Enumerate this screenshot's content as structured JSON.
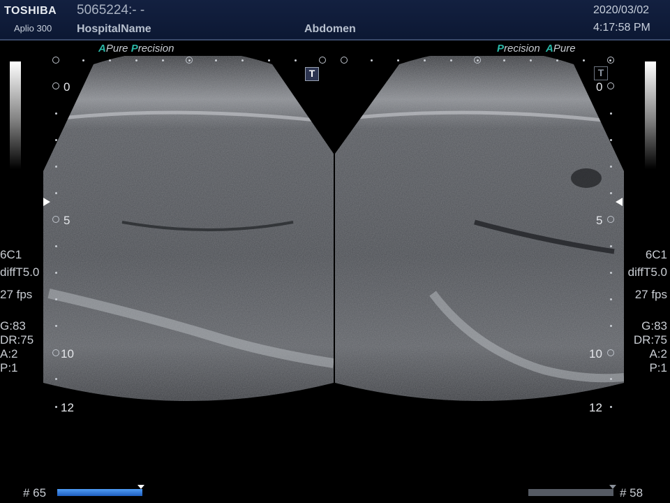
{
  "header": {
    "brand": "TOSHIBA",
    "model": "Aplio 300",
    "patient_id": "5065224:- -",
    "hospital": "HospitalName",
    "exam": "Abdomen",
    "date": "2020/03/02",
    "time": "4:17:58 PM"
  },
  "left_panel": {
    "tags": {
      "a": "A",
      "pure": "Pure",
      "p": "P",
      "recision": "recision"
    },
    "depth_labels": [
      "0",
      "5",
      "10",
      "12"
    ],
    "params": {
      "probe": "6C1",
      "mode": "diffT5.0",
      "fps": "27 fps",
      "gain": "G:83",
      "dr": "DR:75",
      "a": "A:2",
      "p": "P:1"
    },
    "t_button": "T"
  },
  "right_panel": {
    "tags": {
      "p": "P",
      "recision": "recision",
      "a": "A",
      "pure": "Pure"
    },
    "depth_labels": [
      "0",
      "5",
      "10",
      "12"
    ],
    "params": {
      "probe": "6C1",
      "mode": "diffT5.0",
      "fps": "27 fps",
      "gain": "G:83",
      "dr": "DR:75",
      "a": "A:2",
      "p": "P:1"
    },
    "t_button": "T"
  },
  "footer": {
    "left_frame": "# 65",
    "right_frame": "# 58",
    "left_progress": 1.0,
    "right_progress": 1.0
  },
  "colors": {
    "header_bg": "#132040",
    "accent_teal": "#2ab7a7",
    "progress_blue": "#2f7fe0",
    "progress_gray": "#555a63"
  }
}
